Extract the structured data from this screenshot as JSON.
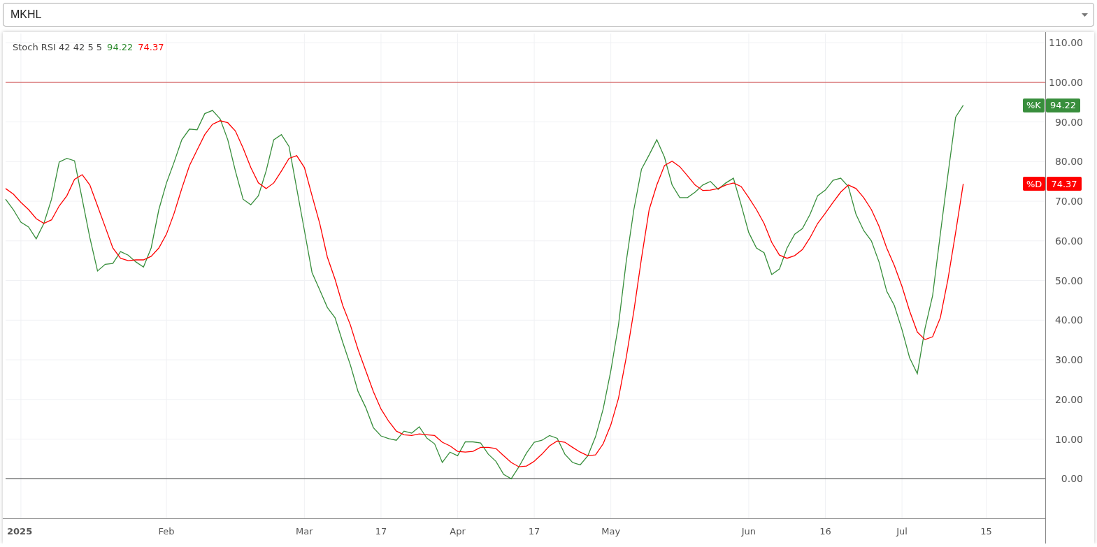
{
  "symbol_select": {
    "value": "MKHL"
  },
  "chart": {
    "legend": {
      "title": "Stoch RSI 42 42 5 5",
      "values": [
        {
          "text": "94.22",
          "color": "#2e8b2e"
        },
        {
          "text": "74.37",
          "color": "#ff0000"
        }
      ]
    },
    "price_tags": [
      {
        "value": "94.22"
      },
      {
        "value": "74.37"
      }
    ],
    "chart_data": {
      "type": "line",
      "categories": [
        null,
        null,
        "2025",
        null,
        null,
        null,
        null,
        null,
        null,
        null,
        null,
        null,
        null,
        null,
        null,
        null,
        null,
        null,
        null,
        null,
        null,
        "Feb",
        null,
        null,
        null,
        null,
        null,
        null,
        null,
        null,
        null,
        null,
        null,
        null,
        null,
        null,
        null,
        null,
        null,
        "Mar",
        null,
        null,
        null,
        null,
        null,
        null,
        null,
        null,
        null,
        "17",
        null,
        null,
        null,
        null,
        null,
        null,
        null,
        null,
        null,
        "Apr",
        null,
        null,
        null,
        null,
        null,
        null,
        null,
        null,
        null,
        "17",
        null,
        null,
        null,
        null,
        null,
        null,
        null,
        null,
        null,
        "May",
        null,
        null,
        null,
        null,
        null,
        null,
        null,
        null,
        null,
        null,
        null,
        null,
        null,
        null,
        null,
        null,
        null,
        "Jun",
        null,
        null,
        null,
        null,
        null,
        null,
        null,
        null,
        null,
        "16",
        null,
        null,
        null,
        null,
        null,
        null,
        null,
        null,
        null,
        "Jul",
        null,
        null,
        null,
        null,
        null,
        null,
        null,
        null,
        null,
        null,
        "15",
        null,
        null,
        null,
        null,
        null,
        null,
        null
      ],
      "series": [
        {
          "name": "%K",
          "color": "#388e3c",
          "values": [
            70.5,
            67.9,
            64.7,
            63.5,
            60.5,
            64.4,
            70.5,
            79.9,
            80.8,
            80.2,
            70.5,
            60.8,
            52.4,
            54.1,
            54.3,
            57.3,
            56.4,
            54.7,
            53.4,
            58.2,
            67.9,
            74.6,
            79.9,
            85.5,
            88.2,
            88.0,
            92.1,
            92.9,
            90.8,
            85.5,
            77.6,
            70.5,
            69.1,
            71.4,
            77.6,
            85.5,
            86.8,
            83.8,
            73.2,
            62.6,
            52.0,
            47.6,
            43.2,
            40.6,
            34.4,
            28.7,
            22.0,
            18.0,
            12.9,
            10.8,
            10.1,
            9.7,
            12.0,
            11.5,
            13.1,
            10.2,
            8.8,
            4.1,
            6.7,
            5.8,
            9.3,
            9.3,
            9.0,
            6.2,
            4.4,
            1.1,
            0.0,
            3.0,
            6.5,
            9.2,
            9.7,
            10.9,
            10.2,
            6.2,
            4.1,
            3.5,
            5.8,
            10.6,
            17.6,
            27.3,
            38.8,
            54.7,
            67.9,
            78.1,
            81.7,
            85.5,
            81.1,
            74.1,
            70.9,
            70.9,
            72.3,
            74.1,
            75.0,
            73.0,
            74.6,
            75.8,
            69.1,
            62.1,
            58.2,
            57.0,
            51.5,
            52.9,
            58.2,
            61.7,
            63.1,
            66.7,
            71.4,
            72.8,
            75.3,
            75.8,
            73.7,
            66.7,
            62.6,
            60.0,
            54.7,
            47.3,
            43.7,
            37.6,
            30.5,
            26.5,
            37.9,
            46.2,
            61.7,
            76.7,
            91.2,
            94.22,
            null,
            null,
            null,
            null,
            null,
            null,
            null,
            null,
            null,
            null
          ]
        },
        {
          "name": "%D",
          "color": "#ff0000",
          "values": [
            73.2,
            71.8,
            69.7,
            67.9,
            65.6,
            64.4,
            65.3,
            68.8,
            71.4,
            75.5,
            76.7,
            74.1,
            68.8,
            63.5,
            58.2,
            55.6,
            55.0,
            55.2,
            55.2,
            56.1,
            58.2,
            61.7,
            67.0,
            73.2,
            79.0,
            82.9,
            86.8,
            89.4,
            90.3,
            89.8,
            87.7,
            83.4,
            78.5,
            74.6,
            73.2,
            74.6,
            77.6,
            80.8,
            81.5,
            78.5,
            71.4,
            64.4,
            55.9,
            50.3,
            43.7,
            38.8,
            32.6,
            27.3,
            22.0,
            17.6,
            14.5,
            12.0,
            11.1,
            10.9,
            11.3,
            11.1,
            10.9,
            9.2,
            8.3,
            6.9,
            6.7,
            6.9,
            7.9,
            7.9,
            7.6,
            5.8,
            4.1,
            3.0,
            3.2,
            4.4,
            6.2,
            8.3,
            9.5,
            9.2,
            7.9,
            6.7,
            5.8,
            6.0,
            8.8,
            13.6,
            20.3,
            30.5,
            42.3,
            55.6,
            67.9,
            74.1,
            79.0,
            80.1,
            78.7,
            76.4,
            74.1,
            72.7,
            72.8,
            73.2,
            74.1,
            74.6,
            73.7,
            70.9,
            67.9,
            64.4,
            59.6,
            56.4,
            55.6,
            56.3,
            57.8,
            60.8,
            64.4,
            67.0,
            69.7,
            72.3,
            74.1,
            73.2,
            70.9,
            67.9,
            63.7,
            58.2,
            53.8,
            48.5,
            42.3,
            37.0,
            35.1,
            35.8,
            40.6,
            50.3,
            62.1,
            74.37,
            null,
            null,
            null,
            null,
            null,
            null,
            null,
            null,
            null,
            null
          ]
        }
      ],
      "ylim": [
        -10,
        112.3
      ],
      "yticks": [
        {
          "value": 0,
          "label": "0.00"
        },
        {
          "value": 10,
          "label": "10.00"
        },
        {
          "value": 20,
          "label": "20.00"
        },
        {
          "value": 30,
          "label": "30.00"
        },
        {
          "value": 40,
          "label": "40.00"
        },
        {
          "value": 50,
          "label": "50.00"
        },
        {
          "value": 60,
          "label": "60.00"
        },
        {
          "value": 70,
          "label": "70.00"
        },
        {
          "value": 80,
          "label": "80.00"
        },
        {
          "value": 90,
          "label": "90.00"
        },
        {
          "value": 100,
          "label": "100.00"
        },
        {
          "value": 110,
          "label": "110.00"
        }
      ],
      "grid": true,
      "ref_lines": [
        {
          "axis": "y",
          "value": 100,
          "color": "#c62828"
        },
        {
          "axis": "y",
          "value": 0,
          "color": "#333333"
        }
      ]
    }
  }
}
